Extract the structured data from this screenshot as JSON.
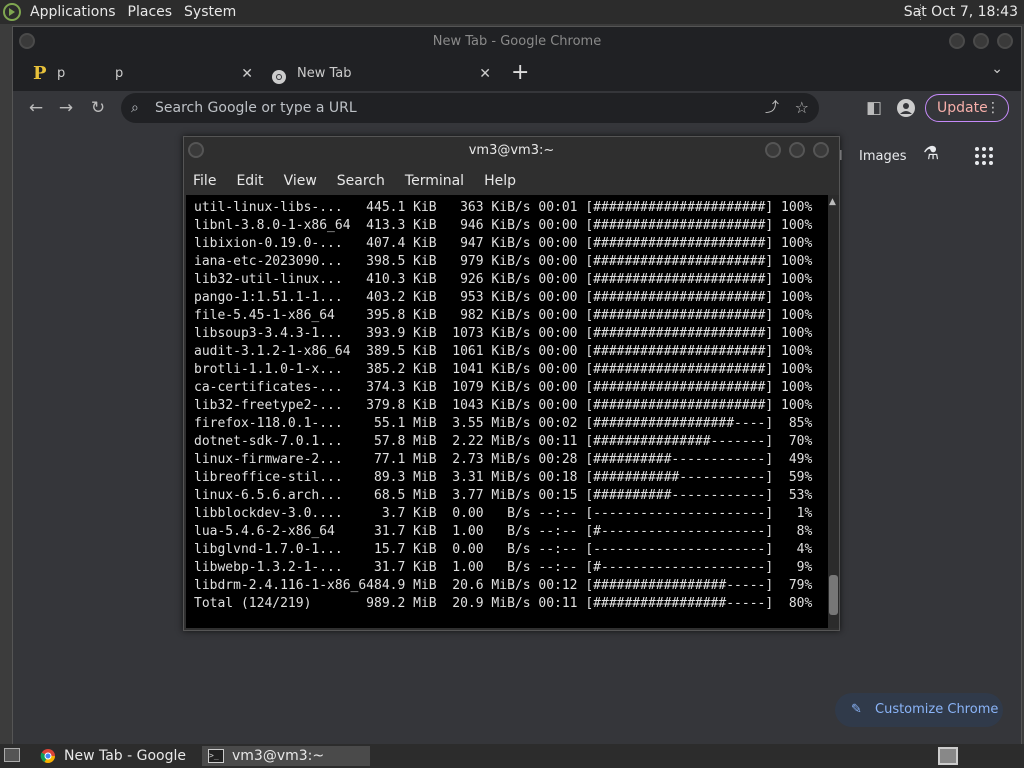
{
  "topbar": {
    "menus": [
      "Applications",
      "Places",
      "System"
    ],
    "clock": "Sat Oct  7, 18:43"
  },
  "chrome": {
    "window_title": "New Tab - Google Chrome",
    "tabs": [
      {
        "icon": "P",
        "label1": "p",
        "label2": "p"
      },
      {
        "label": "New Tab"
      }
    ],
    "new_tab_symbol": "+",
    "omnibox_placeholder": "Search Google or type a URL",
    "update_label": "Update",
    "images_link": "Images",
    "customize_label": "Customize Chrome",
    "accent": "#8ab4f8"
  },
  "terminal": {
    "title": "vm3@vm3:~",
    "menu": [
      "File",
      "Edit",
      "View",
      "Search",
      "Terminal",
      "Help"
    ],
    "lines": [
      "util-linux-libs-...   445.1 KiB   363 KiB/s 00:01 [######################] 100%",
      "libnl-3.8.0-1-x86_64  413.3 KiB   946 KiB/s 00:00 [######################] 100%",
      "libixion-0.19.0-...   407.4 KiB   947 KiB/s 00:00 [######################] 100%",
      "iana-etc-2023090...   398.5 KiB   979 KiB/s 00:00 [######################] 100%",
      "lib32-util-linux...   410.3 KiB   926 KiB/s 00:00 [######################] 100%",
      "pango-1:1.51.1-1...   403.2 KiB   953 KiB/s 00:00 [######################] 100%",
      "file-5.45-1-x86_64    395.8 KiB   982 KiB/s 00:00 [######################] 100%",
      "libsoup3-3.4.3-1...   393.9 KiB  1073 KiB/s 00:00 [######################] 100%",
      "audit-3.1.2-1-x86_64  389.5 KiB  1061 KiB/s 00:00 [######################] 100%",
      "brotli-1.1.0-1-x...   385.2 KiB  1041 KiB/s 00:00 [######################] 100%",
      "ca-certificates-...   374.3 KiB  1079 KiB/s 00:00 [######################] 100%",
      "lib32-freetype2-...   379.8 KiB  1043 KiB/s 00:00 [######################] 100%",
      "firefox-118.0.1-...    55.1 MiB  3.55 MiB/s 00:02 [##################----]  85%",
      "dotnet-sdk-7.0.1...    57.8 MiB  2.22 MiB/s 00:11 [###############-------]  70%",
      "linux-firmware-2...    77.1 MiB  2.73 MiB/s 00:28 [##########------------]  49%",
      "libreoffice-stil...    89.3 MiB  3.31 MiB/s 00:18 [###########-----------]  59%",
      "linux-6.5.6.arch...    68.5 MiB  3.77 MiB/s 00:15 [##########------------]  53%",
      "libblockdev-3.0....     3.7 KiB  0.00   B/s --:-- [----------------------]   1%",
      "lua-5.4.6-2-x86_64     31.7 KiB  1.00   B/s --:-- [#---------------------]   8%",
      "libglvnd-1.7.0-1...    15.7 KiB  0.00   B/s --:-- [----------------------]   4%",
      "libwebp-1.3.2-1-...    31.7 KiB  1.00   B/s --:-- [#---------------------]   9%",
      "libdrm-2.4.116-1-x86_6484.9 MiB  20.6 MiB/s 00:12 [#################-----]  79%",
      "Total (124/219)       989.2 MiB  20.9 MiB/s 00:11 [#################-----]  80%"
    ]
  },
  "taskbar": {
    "items": [
      {
        "label": "New Tab - Google ...",
        "icon": "chrome-icon"
      },
      {
        "label": "vm3@vm3:~",
        "icon": "terminal-icon"
      }
    ]
  }
}
